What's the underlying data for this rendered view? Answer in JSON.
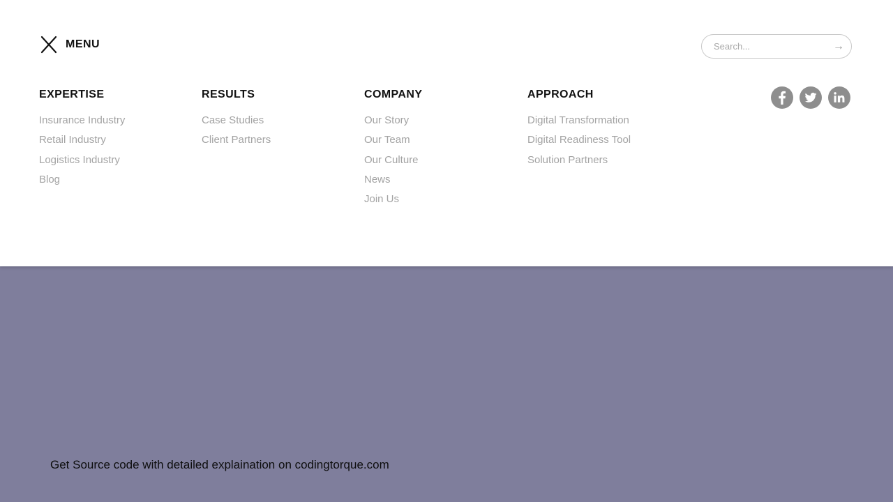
{
  "header": {
    "menu_label": "MENU",
    "close_icon": "close-icon",
    "search": {
      "placeholder": "Search...",
      "value": "",
      "submit_icon": "arrow-right-icon",
      "submit_glyph": "→"
    }
  },
  "columns": [
    {
      "heading": "EXPERTISE",
      "links": [
        "Insurance Industry",
        "Retail Industry",
        "Logistics Industry",
        "Blog"
      ]
    },
    {
      "heading": "RESULTS",
      "links": [
        "Case Studies",
        "Client Partners"
      ]
    },
    {
      "heading": "COMPANY",
      "links": [
        "Our Story",
        "Our Team",
        "Our Culture",
        "News",
        "Join Us"
      ]
    },
    {
      "heading": "APPROACH",
      "links": [
        "Digital Transformation",
        "Digital Readiness Tool",
        "Solution Partners"
      ]
    }
  ],
  "social": {
    "icons": [
      "facebook-icon",
      "twitter-icon",
      "linkedin-icon"
    ],
    "color": "#8e8e8e"
  },
  "footer": {
    "note": "Get Source code with detailed explaination on codingtorque.com"
  },
  "colors": {
    "background": "#7f7e9c",
    "panel": "#ffffff",
    "heading": "#111111",
    "link": "#a3a3a3"
  }
}
